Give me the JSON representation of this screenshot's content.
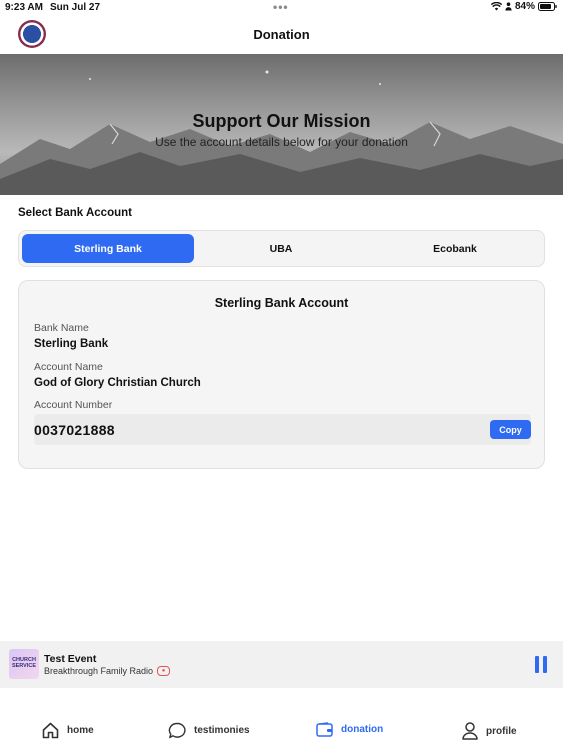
{
  "status_bar": {
    "time": "9:23 AM",
    "date": "Sun Jul 27",
    "battery": "84%"
  },
  "header": {
    "title": "Donation",
    "logo_icon": "church-logo"
  },
  "hero": {
    "title": "Support Our Mission",
    "subtitle": "Use the account details below for your donation"
  },
  "bank_select": {
    "label": "Select Bank Account",
    "tabs": [
      {
        "label": "Sterling Bank",
        "active": true
      },
      {
        "label": "UBA",
        "active": false
      },
      {
        "label": "Ecobank",
        "active": false
      }
    ]
  },
  "account_card": {
    "title": "Sterling Bank Account",
    "bank_name_label": "Bank Name",
    "bank_name": "Sterling Bank",
    "account_name_label": "Account Name",
    "account_name": "God of Glory Christian Church",
    "account_number_label": "Account Number",
    "account_number": "0037021888",
    "copy_label": "Copy"
  },
  "player": {
    "title": "Test Event",
    "subtitle": "Breakthrough Family Radio",
    "thumb_text": "CHURCH SERVICE",
    "state_icon": "pause-icon",
    "accent": "#2f6bf2"
  },
  "tab_bar": {
    "items": [
      {
        "label": "home",
        "icon": "home-icon"
      },
      {
        "label": "testimonies",
        "icon": "chat-bubble-icon"
      },
      {
        "label": "donation",
        "icon": "wallet-icon",
        "active": true
      },
      {
        "label": "profile",
        "icon": "person-icon"
      }
    ]
  },
  "colors": {
    "accent": "#2f6bf2"
  }
}
